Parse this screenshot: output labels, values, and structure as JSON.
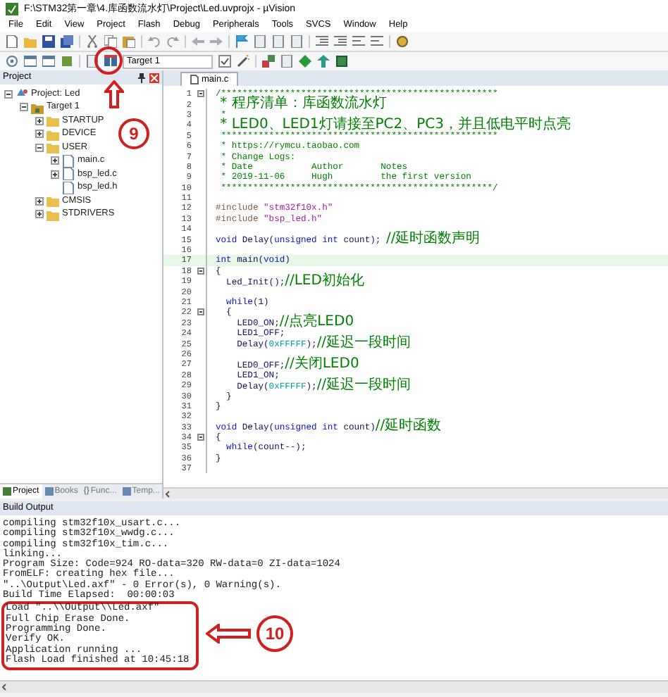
{
  "window": {
    "title": "F:\\STM32第一章\\4.库函数流水灯\\Project\\Led.uvprojx - µVision"
  },
  "menu": [
    "File",
    "Edit",
    "View",
    "Project",
    "Flash",
    "Debug",
    "Peripherals",
    "Tools",
    "SVCS",
    "Window",
    "Help"
  ],
  "target_select": {
    "value": "Target 1"
  },
  "project_panel": {
    "title": "Project",
    "tree": [
      {
        "label": "Project: Led",
        "kind": "project",
        "expanded": true,
        "children": [
          {
            "label": "Target 1",
            "kind": "target",
            "expanded": true,
            "children": [
              {
                "label": "STARTUP",
                "kind": "group",
                "expanded": false
              },
              {
                "label": "DEVICE",
                "kind": "group",
                "expanded": false
              },
              {
                "label": "USER",
                "kind": "group",
                "expanded": true,
                "children": [
                  {
                    "label": "main.c",
                    "kind": "file",
                    "expanded": false
                  },
                  {
                    "label": "bsp_led.c",
                    "kind": "file",
                    "expanded": false
                  },
                  {
                    "label": "bsp_led.h",
                    "kind": "file"
                  }
                ]
              },
              {
                "label": "CMSIS",
                "kind": "group",
                "expanded": false
              },
              {
                "label": "STDRIVERS",
                "kind": "group",
                "expanded": false
              }
            ]
          }
        ]
      }
    ],
    "tabs": [
      {
        "label": "Project",
        "selected": true
      },
      {
        "label": "Books",
        "selected": false
      },
      {
        "label": "Func...",
        "icon_text": "{}",
        "selected": false
      },
      {
        "label": "Temp...",
        "selected": false
      }
    ]
  },
  "editor": {
    "tabs": [
      {
        "label": "main.c",
        "selected": true
      }
    ],
    "lines": [
      {
        "n": "1",
        "fold": true,
        "segs": [
          {
            "kind": "comment",
            "t": "/****************************************************"
          }
        ]
      },
      {
        "n": "2",
        "segs": [
          {
            "kind": "comment",
            "t": " * 程序清单：库函数流水灯"
          }
        ]
      },
      {
        "n": "3",
        "segs": [
          {
            "kind": "comment",
            "t": " *"
          }
        ]
      },
      {
        "n": "4",
        "segs": [
          {
            "kind": "comment",
            "t": " * LED0、LED1灯请接至PC2、PC3，并且低电平时点亮"
          }
        ]
      },
      {
        "n": "5",
        "segs": [
          {
            "kind": "comment",
            "t": " ****************************************************"
          }
        ]
      },
      {
        "n": "6",
        "segs": [
          {
            "kind": "comment",
            "t": " * https://rymcu.taobao.com"
          }
        ]
      },
      {
        "n": "7",
        "segs": [
          {
            "kind": "comment",
            "t": " * Change Logs:"
          }
        ]
      },
      {
        "n": "8",
        "segs": [
          {
            "kind": "comment",
            "t": " * Date           Author       Notes"
          }
        ]
      },
      {
        "n": "9",
        "segs": [
          {
            "kind": "comment",
            "t": " * 2019-11-06     Hugh         the first version"
          }
        ]
      },
      {
        "n": "10",
        "segs": [
          {
            "kind": "comment",
            "t": " ***************************************************/"
          }
        ]
      },
      {
        "n": "11"
      },
      {
        "n": "12",
        "segs": [
          {
            "kind": "pre",
            "t": "#include "
          },
          {
            "kind": "str",
            "t": "\"stm32f10x.h\""
          }
        ]
      },
      {
        "n": "13",
        "segs": [
          {
            "kind": "pre",
            "t": "#include "
          },
          {
            "kind": "str",
            "t": "\"bsp_led.h\""
          }
        ]
      },
      {
        "n": "14"
      },
      {
        "n": "15",
        "segs": [
          {
            "kind": "kw",
            "t": "void"
          },
          {
            "kind": "code",
            "t": " Delay("
          },
          {
            "kind": "kw",
            "t": "unsigned int"
          },
          {
            "kind": "code",
            "t": " count); "
          },
          {
            "kind": "comment",
            "t": "//延时函数声明"
          }
        ]
      },
      {
        "n": "16"
      },
      {
        "n": "17",
        "current": true,
        "segs": [
          {
            "kind": "kw",
            "t": "int"
          },
          {
            "kind": "code",
            "t": " main("
          },
          {
            "kind": "kw",
            "t": "void"
          },
          {
            "kind": "code",
            "t": ")"
          }
        ]
      },
      {
        "n": "18",
        "fold": true,
        "segs": [
          {
            "kind": "code",
            "t": "{"
          }
        ]
      },
      {
        "n": "19",
        "segs": [
          {
            "kind": "code",
            "t": "  Led_Init();"
          },
          {
            "kind": "comment",
            "t": "//LED初始化"
          }
        ]
      },
      {
        "n": "20"
      },
      {
        "n": "21",
        "segs": [
          {
            "kind": "kw",
            "t": "  while"
          },
          {
            "kind": "code",
            "t": "(1)"
          }
        ]
      },
      {
        "n": "22",
        "fold": true,
        "segs": [
          {
            "kind": "code",
            "t": "  {"
          }
        ]
      },
      {
        "n": "23",
        "segs": [
          {
            "kind": "code",
            "t": "    LED0_ON;"
          },
          {
            "kind": "comment",
            "t": "//点亮LED0"
          }
        ]
      },
      {
        "n": "24",
        "segs": [
          {
            "kind": "code",
            "t": "    LED1_OFF;"
          }
        ]
      },
      {
        "n": "25",
        "segs": [
          {
            "kind": "code",
            "t": "    Delay("
          },
          {
            "kind": "num",
            "t": "0xFFFFF"
          },
          {
            "kind": "code",
            "t": ");"
          },
          {
            "kind": "comment",
            "t": "//延迟一段时间"
          }
        ]
      },
      {
        "n": "26"
      },
      {
        "n": "27",
        "segs": [
          {
            "kind": "code",
            "t": "    LED0_OFF;"
          },
          {
            "kind": "comment",
            "t": "//关闭LED0"
          }
        ]
      },
      {
        "n": "28",
        "segs": [
          {
            "kind": "code",
            "t": "    LED1_ON;"
          }
        ]
      },
      {
        "n": "29",
        "segs": [
          {
            "kind": "code",
            "t": "    Delay("
          },
          {
            "kind": "num",
            "t": "0xFFFFF"
          },
          {
            "kind": "code",
            "t": ");"
          },
          {
            "kind": "comment",
            "t": "//延迟一段时间"
          }
        ]
      },
      {
        "n": "30",
        "segs": [
          {
            "kind": "code",
            "t": "  }"
          }
        ]
      },
      {
        "n": "31",
        "segs": [
          {
            "kind": "code",
            "t": "}"
          }
        ]
      },
      {
        "n": "32"
      },
      {
        "n": "33",
        "segs": [
          {
            "kind": "kw",
            "t": "void"
          },
          {
            "kind": "code",
            "t": " Delay("
          },
          {
            "kind": "kw",
            "t": "unsigned int"
          },
          {
            "kind": "code",
            "t": " count)"
          },
          {
            "kind": "comment",
            "t": "//延时函数"
          }
        ]
      },
      {
        "n": "34",
        "fold": true,
        "segs": [
          {
            "kind": "code",
            "t": "{"
          }
        ]
      },
      {
        "n": "35",
        "segs": [
          {
            "kind": "kw",
            "t": "  while"
          },
          {
            "kind": "code",
            "t": "(count--);"
          }
        ]
      },
      {
        "n": "36",
        "segs": [
          {
            "kind": "code",
            "t": "}"
          }
        ]
      },
      {
        "n": "37"
      }
    ]
  },
  "build_output": {
    "title": "Build Output",
    "lines": [
      "compiling stm32f10x_usart.c...",
      "compiling stm32f10x_wwdg.c...",
      "compiling stm32f10x_tim.c...",
      "linking...",
      "Program Size: Code=924 RO-data=320 RW-data=0 ZI-data=1024",
      "FromELF: creating hex file...",
      "\"..\\Output\\Led.axf\" - 0 Error(s), 0 Warning(s).",
      "Build Time Elapsed:  00:00:03"
    ],
    "boxed_lines": [
      "Load \"..\\\\Output\\\\Led.axf\"",
      "Full Chip Erase Done.",
      "Programming Done.",
      "Verify OK.",
      "Application running ...",
      "Flash Load finished at 10:45:18"
    ]
  },
  "annotations": [
    {
      "label": "9"
    },
    {
      "label": "10"
    }
  ]
}
